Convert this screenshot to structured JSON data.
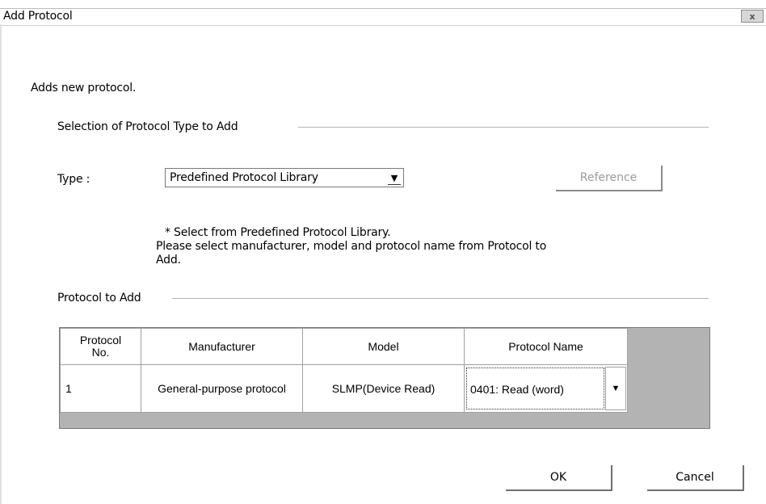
{
  "window": {
    "title": "Add Protocol",
    "close_glyph": "x"
  },
  "description": "Adds new protocol.",
  "type_group": {
    "heading": "Selection of Protocol Type to Add",
    "type_label": "Type :",
    "type_value": "Predefined Protocol Library",
    "reference_label": "Reference",
    "note_line1": "* Select from Predefined Protocol Library.",
    "note_line2": "Please select manufacturer, model and protocol name from Protocol to",
    "note_line3": "Add."
  },
  "protocol_group": {
    "heading": "Protocol to Add",
    "columns": [
      "Protocol\nNo.",
      "Manufacturer",
      "Model",
      "Protocol Name"
    ],
    "col_no_line1": "Protocol",
    "col_no_line2": "No.",
    "rows": [
      {
        "no": "1",
        "manufacturer": "General-purpose protocol",
        "model": "SLMP(Device Read)",
        "protocol_name": "0401: Read (word)"
      }
    ]
  },
  "buttons": {
    "ok": "OK",
    "cancel": "Cancel"
  },
  "colors": {
    "grid_background": "#b3b3b3",
    "disabled_text": "#9a9a9a"
  }
}
